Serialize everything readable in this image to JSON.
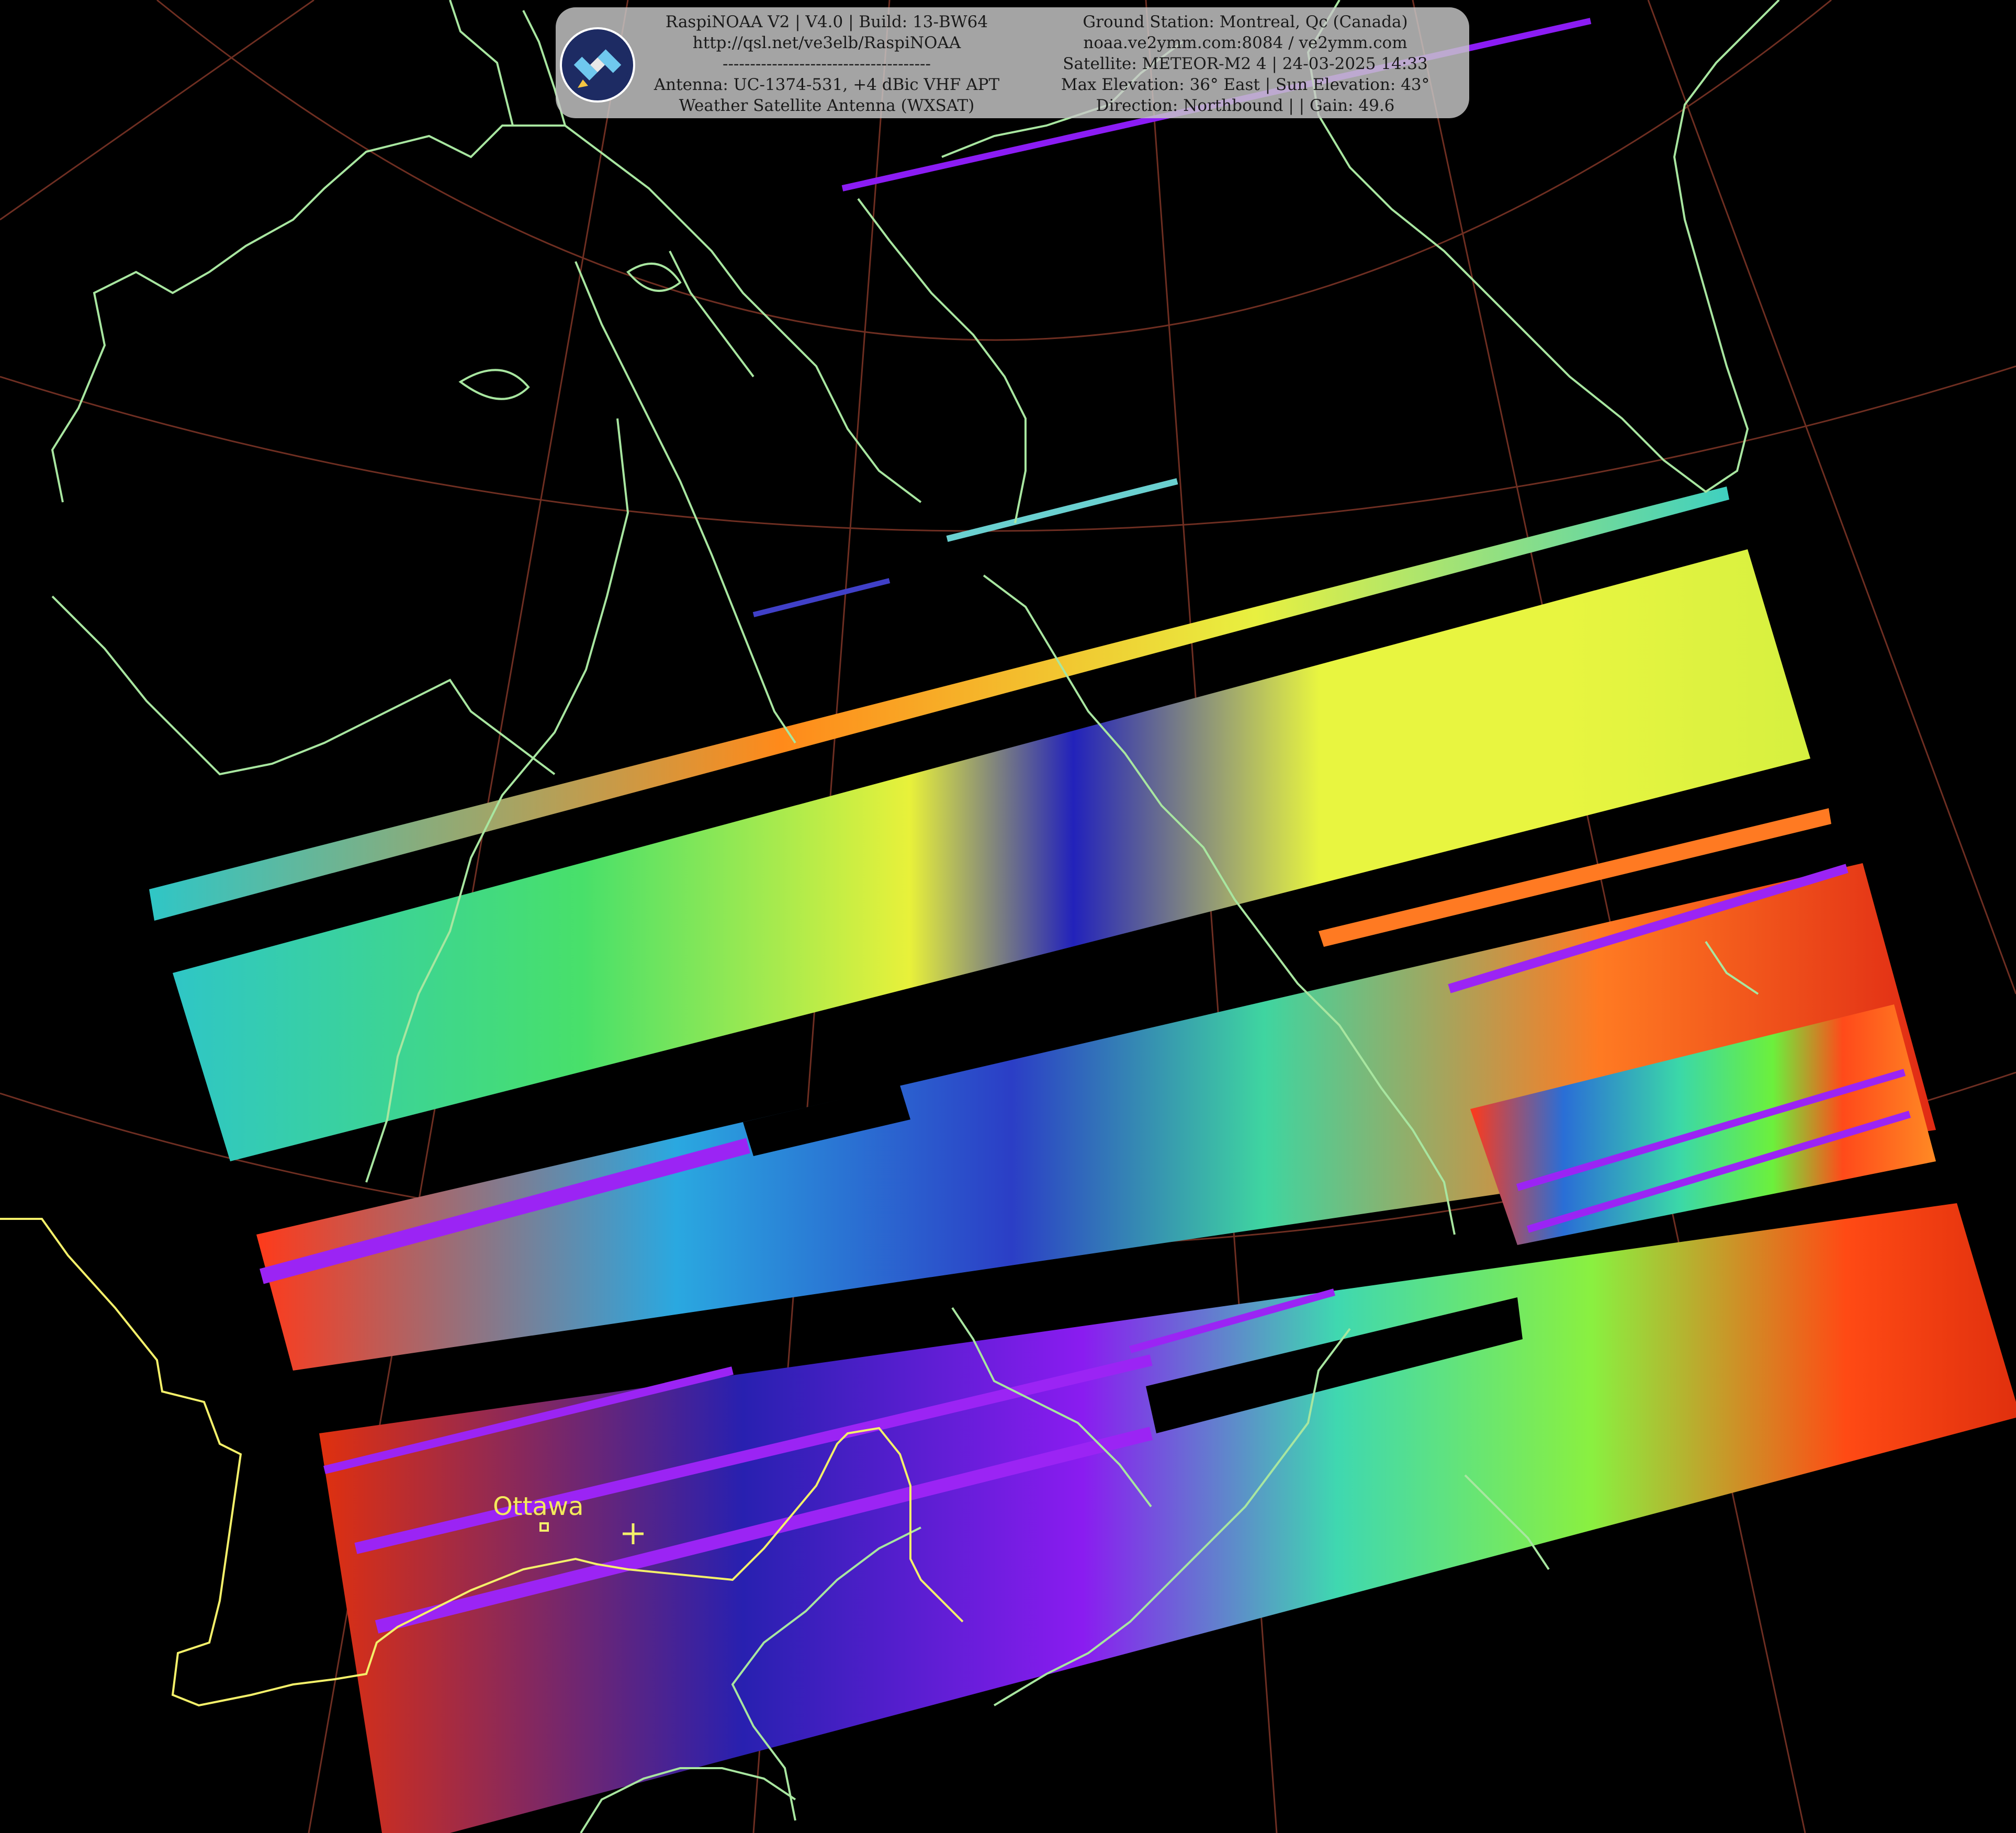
{
  "banner": {
    "left_lines": [
      "RaspiNOAA V2 | V4.0 | Build: 13-BW64",
      "http://qsl.net/ve3elb/RaspiNOAA",
      "--------------------------------------",
      "Antenna: UC-1374-531, +4 dBic VHF APT",
      "Weather Satellite Antenna (WXSAT)"
    ],
    "right_lines": [
      "Ground Station: Montreal, Qc (Canada)",
      "noaa.ve2ymm.com:8084 / ve2ymm.com",
      "Satellite: METEOR-M2 4 | 24-03-2025 14:33",
      "Max Elevation: 36° East | Sun Elevation: 43°",
      "Direction: Northbound | | Gain: 49.6"
    ]
  },
  "map": {
    "city_label": "Ottawa",
    "colors": {
      "background": "#000000",
      "coastline": "#a8e6a0",
      "border": "#f4f06a",
      "graticule": "#8a3a2a"
    }
  },
  "icons": {
    "logo": "satellite-logo-icon",
    "station": "ground-station-cross-icon"
  }
}
